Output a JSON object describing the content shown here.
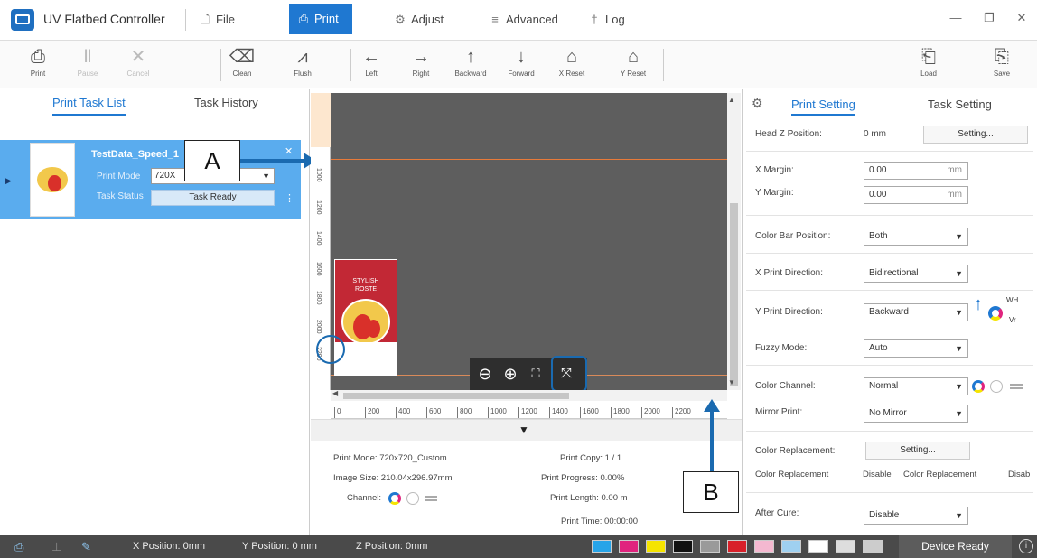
{
  "app": {
    "title": "UV Flatbed Controller"
  },
  "menu": [
    {
      "label": "File",
      "icon": "file-icon",
      "glyph": "🗋"
    },
    {
      "label": "Print",
      "icon": "print-icon",
      "glyph": "⎙"
    },
    {
      "label": "Adjust",
      "icon": "gear-icon",
      "glyph": "⚙"
    },
    {
      "label": "Advanced",
      "icon": "sliders-icon",
      "glyph": "≡"
    },
    {
      "label": "Log",
      "icon": "pin-icon",
      "glyph": "†"
    }
  ],
  "toolbar": [
    {
      "label": "Print",
      "glyph": "⎙",
      "disabled": false
    },
    {
      "label": "Pause",
      "glyph": "Ⅱ",
      "disabled": true
    },
    {
      "label": "Cancel",
      "glyph": "✕",
      "disabled": true
    },
    {
      "label": "Clean",
      "glyph": "⌫",
      "disabled": false
    },
    {
      "label": "Flush",
      "glyph": "⩘",
      "disabled": false
    },
    {
      "label": "Left",
      "glyph": "←",
      "disabled": false
    },
    {
      "label": "Right",
      "glyph": "→",
      "disabled": false
    },
    {
      "label": "Backward",
      "glyph": "↑",
      "disabled": false
    },
    {
      "label": "Forward",
      "glyph": "↓",
      "disabled": false
    },
    {
      "label": "X Reset",
      "glyph": "⌂",
      "disabled": false
    },
    {
      "label": "Y Reset",
      "glyph": "⌂",
      "disabled": false
    },
    {
      "label": "Load",
      "glyph": "⎗",
      "disabled": false
    },
    {
      "label": "Save",
      "glyph": "⎘",
      "disabled": false
    }
  ],
  "left_panel": {
    "tab_print_list": "Print Task List",
    "tab_history": "Task History",
    "task": {
      "name": "TestData_Speed_1",
      "print_mode_label": "Print Mode",
      "print_mode_value": "720X",
      "task_status_label": "Task Status",
      "task_status_value": "Task Ready"
    }
  },
  "callouts": {
    "a": "A",
    "b": "B"
  },
  "poster": {
    "line1": "STYLISH",
    "line2": "ROSTE"
  },
  "canvas": {
    "vruler": [
      "1000",
      "1200",
      "1400",
      "1600",
      "1800",
      "2000",
      "2200"
    ],
    "hruler": [
      "0",
      "200",
      "400",
      "600",
      "800",
      "1000",
      "1200",
      "1400",
      "1600",
      "1800",
      "2000",
      "2200"
    ],
    "zoom_controls": [
      "zoom-out",
      "zoom-in",
      "fit",
      "actual-size"
    ]
  },
  "print_info": {
    "print_mode": "Print Mode: 720x720_Custom",
    "image_size": "Image Size: 210.04x296.97mm",
    "channel": "Channel:",
    "print_copy": "Print Copy: 1 / 1",
    "print_progress": "Print Progress: 0.00%",
    "print_length": "Print Length: 0.00 m",
    "print_time": "Print Time: 00:00:00"
  },
  "right_panel": {
    "tab_print": "Print Setting",
    "tab_task": "Task Setting",
    "head_z_label": "Head Z Position:",
    "head_z_value": "0 mm",
    "head_z_button": "Setting...",
    "x_margin_label": "X Margin:",
    "x_margin_value": "0.00",
    "y_margin_label": "Y Margin:",
    "y_margin_value": "0.00",
    "unit_mm": "mm",
    "color_bar_label": "Color Bar Position:",
    "color_bar_value": "Both",
    "x_dir_label": "X Print Direction:",
    "x_dir_value": "Bidirectional",
    "y_dir_label": "Y Print Direction:",
    "y_dir_value": "Backward",
    "wh_label": "WH",
    "vr_label": "Vr",
    "fuzzy_label": "Fuzzy Mode:",
    "fuzzy_value": "Auto",
    "color_channel_label": "Color Channel:",
    "color_channel_value": "Normal",
    "mirror_label": "Mirror Print:",
    "mirror_value": "No Mirror",
    "color_repl_label": "Color Replacement:",
    "color_repl_button": "Setting...",
    "color_repl_status_1": "Color Replacement",
    "color_repl_status_1_value": "Disable",
    "color_repl_status_2": "Color Replacement",
    "color_repl_status_2_value": "Disab",
    "after_cure_label": "After Cure:",
    "after_cure_value": "Disable"
  },
  "status_bar": {
    "x_position": "X Position: 0mm",
    "y_position": "Y Position: 0 mm",
    "z_position": "Z Position: 0mm",
    "device_status": "Device Ready",
    "ink_colors": [
      "#27a4e8",
      "#e0247e",
      "#f5e400",
      "#111111",
      "#9a9a9a",
      "#d8202a",
      "#f4b8d0",
      "#9fd0f0",
      "#ffffff",
      "#dddddd",
      "#cccccc"
    ]
  },
  "colors": {
    "accent": "#1f78d1",
    "task_selected": "#5aacee",
    "guide": "#e77a3a"
  }
}
